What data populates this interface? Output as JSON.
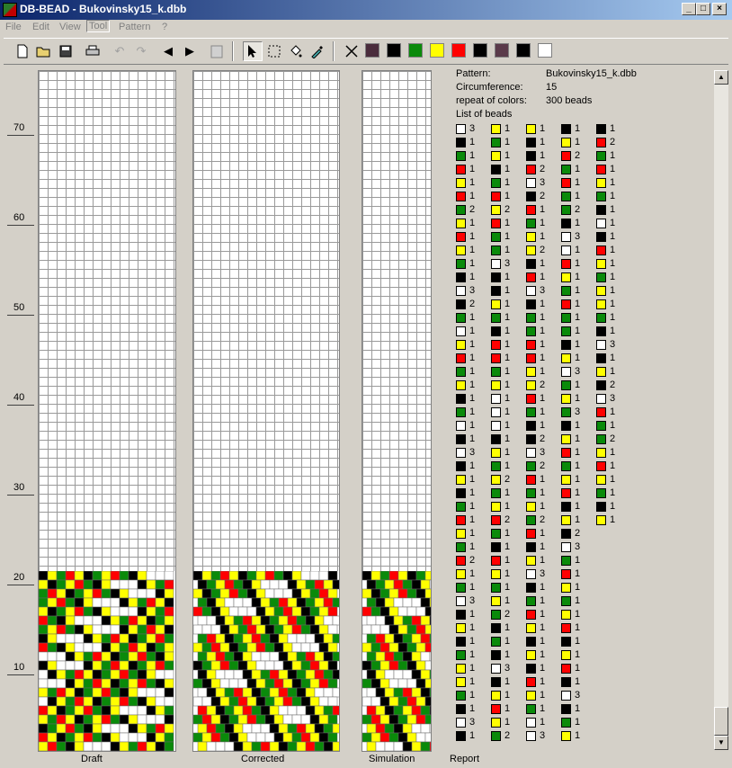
{
  "window": {
    "title": "DB-BEAD - Bukovinsky15_k.dbb",
    "min": "_",
    "max": "□",
    "close": "×"
  },
  "menu": [
    "File",
    "Edit",
    "View",
    "Tool",
    "Pattern",
    "?"
  ],
  "toolbar": {
    "icons": [
      "new-icon",
      "open-icon",
      "save-icon",
      "print-icon",
      "undo-icon",
      "redo-icon",
      "arrow-left-icon",
      "arrow-right-icon",
      "paste-icon",
      "pointer-icon",
      "select-icon",
      "fill-icon",
      "eyedropper-icon",
      "clear-icon"
    ],
    "palette": [
      "#4a2c3c",
      "#000000",
      "#0a8a0a",
      "#ffff00",
      "#ff0000",
      "#000000",
      "#5a3a4a",
      "#000000",
      "#ffffff"
    ]
  },
  "ruler": [
    "70",
    "60",
    "50",
    "40",
    "30",
    "20",
    "10"
  ],
  "columns": {
    "draft": "Draft",
    "corrected": "Corrected",
    "simulation": "Simulation",
    "report": "Report"
  },
  "report": {
    "pattern_label": "Pattern:",
    "pattern_value": "Bukovinsky15_k.dbb",
    "circ_label": "Circumference:",
    "circ_value": "15",
    "repeat_label": "repeat of colors:",
    "repeat_value": "300 beads",
    "list_label": "List of beads"
  },
  "colors": {
    "K": "#000000",
    "W": "#ffffff",
    "G": "#0a8a0a",
    "Y": "#ffff00",
    "R": "#ff0000"
  },
  "bead_list": [
    "W3 K1 G1 R1 Y1 R1 G2 Y1 R1 Y1 G1 K1 W3 K2 G1 W1 Y1 R1 G1 Y1 K1 G1 W1 K1 W3 K1 Y1 K1 G1 R1 Y1 G1 R2 Y1 G1 W3 K1 Y1 K1 G1 Y1 Y1",
    "G1 K1 W3 K1 Y1 G1 Y1 K1 G1 R1 Y2 R1 G1 G1 W3 K1 K1 Y1 G1 K1 R1 R1 G1 Y1 W1 W1 W1 K1 Y1 G1 Y2 G1 Y1 R2 G1 K1 R1 Y1 G1 Y1 G2 K1",
    "G1 K1 W3 K1 Y1 R1 Y1 G2 Y1 K1 K1 R2 W3 K2 R1 G1 Y1 Y2 K1 R1 W3 K1 G1 G1 R1 R1 Y1 Y2 R1 G1 K1 K2 W3 G2 R1 G1 Y1 G2 R1 K1 Y1",
    "W3 K1 G1 R1 Y1 K1 Y1 K1 R1 Y1 G1 W1 W3 K1 Y1 R2 G1 R1 G1 G2 K1 W3 W1 R1 Y1 G1 R1 G1 G1 K1 Y1 W3 G1 Y1 G3 K1 Y1 R1 G1 Y1 R1 K1",
    "Y1 K2 W3 G1 R1 Y1 G1 Y1 R1 K1 Y1 R1 K1 W3 K1 G1 Y1 K1 R2 G1 R1 Y1 G1 K1 W1 K1 R1 Y1 G1 Y1 Y1 G1 K1 W3 K1 Y1 K2 W3 R1 G1 G2 Y1",
    "R1 Y1 G1 K1 Y1"
  ]
}
